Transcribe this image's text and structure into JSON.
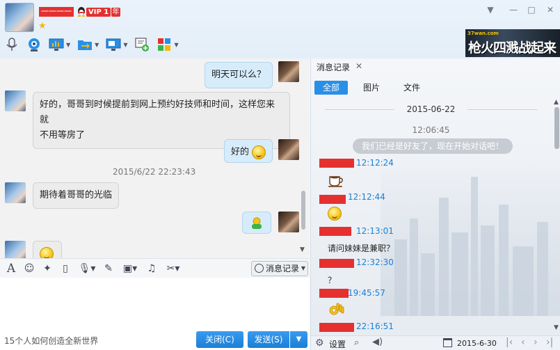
{
  "header": {
    "contact_name": "一一一一",
    "vip_label": "VIP 1",
    "year_label": "年",
    "window_controls": [
      "chevron-down-icon",
      "minimize-icon",
      "maximize-icon",
      "close-icon"
    ],
    "banner": {
      "logo_text": "37wan.com",
      "title": "枪火四溅战起来"
    }
  },
  "chat": {
    "messages": [
      {
        "side": "out",
        "text": "明天可以么？"
      },
      {
        "side": "in",
        "text_line1": "好的，哥哥到时候提前到网上预约好技师和时间，这样您来就",
        "text_line2": "不用等房了"
      },
      {
        "side": "out",
        "text": "好的"
      },
      {
        "side": "in",
        "text": "期待着哥哥的光临"
      }
    ],
    "timestamp": "2015/6/22 22:23:43"
  },
  "input_toolbar": {
    "history_button": "消息记录"
  },
  "footer": {
    "tip": "15个人如何创造全新世界",
    "close_button": "关闭(C)",
    "send_button": "发送(S)"
  },
  "history": {
    "tab_label": "消息记录",
    "filters": [
      "全部",
      "图片",
      "文件"
    ],
    "date": "2015-06-22",
    "time": "12:06:45",
    "notice": "我们已经是好友了，现在开始对话吧！",
    "entries": [
      {
        "time": "12:12:24"
      },
      {
        "time": "12:12:44"
      },
      {
        "time": "12:13:01"
      },
      {
        "time": "12:32:30",
        "text": "请问妹妹是兼职？"
      },
      {
        "time": "19:45:57",
        "text": "？"
      },
      {
        "time": "22:16:51"
      }
    ],
    "footer": {
      "settings_label": "设置",
      "date_value": "2015-6-30"
    }
  }
}
